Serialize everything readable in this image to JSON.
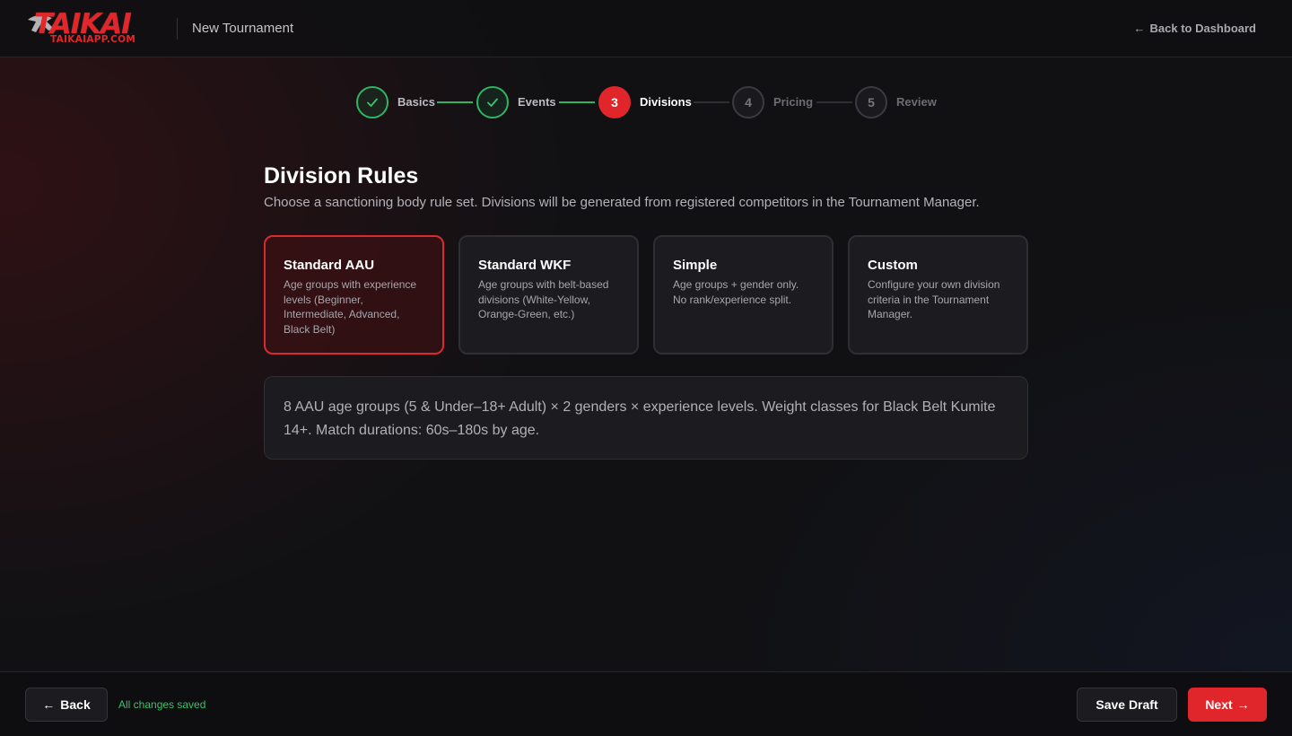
{
  "header": {
    "logo_text": "TAIKAI",
    "logo_sub": "TAIKAIAPP.COM",
    "title": "New Tournament",
    "back_link": "Back to Dashboard"
  },
  "stepper": {
    "steps": [
      {
        "number": "1",
        "label": "Basics",
        "status": "completed"
      },
      {
        "number": "2",
        "label": "Events",
        "status": "completed"
      },
      {
        "number": "3",
        "label": "Divisions",
        "status": "active"
      },
      {
        "number": "4",
        "label": "Pricing",
        "status": "upcoming"
      },
      {
        "number": "5",
        "label": "Review",
        "status": "upcoming"
      }
    ]
  },
  "main": {
    "title": "Division Rules",
    "subtitle": "Choose a sanctioning body rule set. Divisions will be generated from registered competitors in the Tournament Manager.",
    "rule_sets": [
      {
        "title": "Standard AAU",
        "description": "Age groups with experience levels (Beginner, Intermediate, Advanced, Black Belt)",
        "selected": true
      },
      {
        "title": "Standard WKF",
        "description": "Age groups with belt-based divisions (White-Yellow, Orange-Green, etc.)",
        "selected": false
      },
      {
        "title": "Simple",
        "description": "Age groups + gender only. No rank/experience split.",
        "selected": false
      },
      {
        "title": "Custom",
        "description": "Configure your own division criteria in the Tournament Manager.",
        "selected": false
      }
    ],
    "info": "8 AAU age groups (5 & Under–18+ Adult) × 2 genders × experience levels. Weight classes for Black Belt Kumite 14+. Match durations: 60s–180s by age."
  },
  "footer": {
    "back_label": "Back",
    "save_status": "All changes saved",
    "save_draft_label": "Save Draft",
    "next_label": "Next"
  },
  "colors": {
    "accent": "#e0262a",
    "success": "#2fb463",
    "background": "#111114",
    "card": "#1c1c20"
  }
}
